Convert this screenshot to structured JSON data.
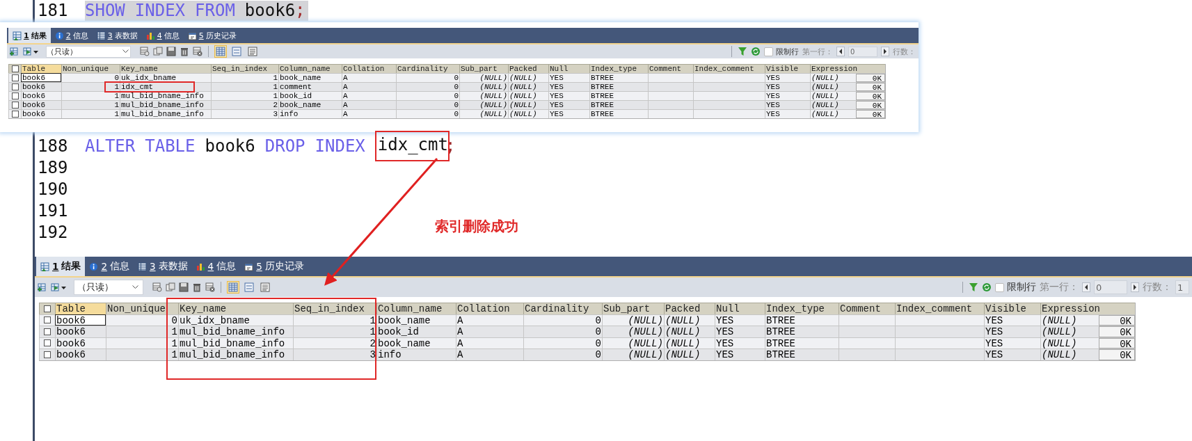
{
  "editor_before": {
    "lines": [
      {
        "number": "181",
        "selected": true,
        "tokens": [
          {
            "text": "SHOW",
            "kind": "keyword"
          },
          {
            "text": "INDEX",
            "kind": "keyword"
          },
          {
            "text": "FROM",
            "kind": "keyword"
          },
          {
            "text": "book6",
            "kind": "ident"
          },
          {
            "text": ";",
            "kind": "punct"
          }
        ]
      }
    ]
  },
  "result_panel_before": {
    "tabs": [
      {
        "number": "1",
        "label": "结果",
        "selected": true
      },
      {
        "number": "2",
        "label": "信息",
        "selected": false
      },
      {
        "number": "3",
        "label": "表数据",
        "selected": false
      },
      {
        "number": "4",
        "label": "信息",
        "selected": false
      },
      {
        "number": "5",
        "label": "历史记录",
        "selected": false
      }
    ],
    "mode": "（只读）",
    "views": [
      {
        "selected": true
      },
      {
        "selected": false
      },
      {
        "selected": false
      }
    ],
    "limit": {
      "label": "限制行",
      "checked": false
    },
    "first_row": {
      "label": "第一行：",
      "value": "0"
    },
    "row_count": {
      "label": "行数："
    },
    "all_checked": false,
    "columns": [
      {
        "name": "Table",
        "selected": true
      },
      {
        "name": "Non_unique",
        "selected": false
      },
      {
        "name": "Key_name",
        "selected": false
      },
      {
        "name": "Seq_in_index",
        "selected": false
      },
      {
        "name": "Column_name",
        "selected": false
      },
      {
        "name": "Collation",
        "selected": false
      },
      {
        "name": "Cardinality",
        "selected": false
      },
      {
        "name": "Sub_part",
        "selected": false
      },
      {
        "name": "Packed",
        "selected": false
      },
      {
        "name": "Null",
        "selected": false
      },
      {
        "name": "Index_type",
        "selected": false
      },
      {
        "name": "Comment",
        "selected": false
      },
      {
        "name": "Index_comment",
        "selected": false
      },
      {
        "name": "Visible",
        "selected": false
      },
      {
        "name": "Expression",
        "selected": false
      }
    ],
    "rows": [
      {
        "checked": false,
        "current": true,
        "cells": [
          "book6",
          "0",
          "uk_idx_bname",
          "1",
          "book_name",
          "A",
          "0",
          "(NULL)",
          "(NULL)",
          "YES",
          "BTREE",
          "",
          "",
          "YES",
          "(NULL)"
        ],
        "size": "0K"
      },
      {
        "checked": false,
        "current": false,
        "cells": [
          "book6",
          "1",
          "idx_cmt",
          "1",
          "comment",
          "A",
          "0",
          "(NULL)",
          "(NULL)",
          "YES",
          "BTREE",
          "",
          "",
          "YES",
          "(NULL)"
        ],
        "size": "0K"
      },
      {
        "checked": false,
        "current": false,
        "cells": [
          "book6",
          "1",
          "mul_bid_bname_info",
          "1",
          "book_id",
          "A",
          "0",
          "(NULL)",
          "(NULL)",
          "YES",
          "BTREE",
          "",
          "",
          "YES",
          "(NULL)"
        ],
        "size": "0K"
      },
      {
        "checked": false,
        "current": false,
        "cells": [
          "book6",
          "1",
          "mul_bid_bname_info",
          "2",
          "book_name",
          "A",
          "0",
          "(NULL)",
          "(NULL)",
          "YES",
          "BTREE",
          "",
          "",
          "YES",
          "(NULL)"
        ],
        "size": "0K"
      },
      {
        "checked": false,
        "current": false,
        "cells": [
          "book6",
          "1",
          "mul_bid_bname_info",
          "3",
          "info",
          "A",
          "0",
          "(NULL)",
          "(NULL)",
          "YES",
          "BTREE",
          "",
          "",
          "YES",
          "(NULL)"
        ],
        "size": "0K"
      }
    ]
  },
  "editor": {
    "lines": [
      {
        "number": "188",
        "selected": false,
        "tokens": [
          {
            "text": "ALTER",
            "kind": "keyword"
          },
          {
            "text": "TABLE",
            "kind": "keyword"
          },
          {
            "text": "book6",
            "kind": "ident"
          },
          {
            "text": "DROP",
            "kind": "keyword"
          },
          {
            "text": "INDEX",
            "kind": "keyword"
          },
          {
            "text": "idx_cmt",
            "kind": "circled"
          },
          {
            "text": ";",
            "kind": "punct"
          }
        ]
      },
      {
        "number": "189",
        "selected": false
      },
      {
        "number": "190",
        "selected": false
      },
      {
        "number": "191",
        "selected": false
      },
      {
        "number": "192",
        "selected": false
      }
    ]
  },
  "annotation": {
    "text": "索引删除成功"
  },
  "result_panel_after": {
    "tabs": [
      {
        "number": "1",
        "label": "结果",
        "selected": true
      },
      {
        "number": "2",
        "label": "信息",
        "selected": false
      },
      {
        "number": "3",
        "label": "表数据",
        "selected": false
      },
      {
        "number": "4",
        "label": "信息",
        "selected": false
      },
      {
        "number": "5",
        "label": "历史记录",
        "selected": false
      }
    ],
    "mode": "（只读）",
    "views": [
      {
        "selected": true
      },
      {
        "selected": false
      },
      {
        "selected": false
      }
    ],
    "limit": {
      "label": "限制行",
      "checked": false
    },
    "first_row": {
      "label": "第一行：",
      "value": "0"
    },
    "row_count": {
      "label": "行数：",
      "value": "1"
    },
    "all_checked": false,
    "columns": [
      {
        "name": "Table",
        "selected": true
      },
      {
        "name": "Non_unique",
        "selected": false
      },
      {
        "name": "Key_name",
        "selected": false
      },
      {
        "name": "Seq_in_index",
        "selected": false
      },
      {
        "name": "Column_name",
        "selected": false
      },
      {
        "name": "Collation",
        "selected": false
      },
      {
        "name": "Cardinality",
        "selected": false
      },
      {
        "name": "Sub_part",
        "selected": false
      },
      {
        "name": "Packed",
        "selected": false
      },
      {
        "name": "Null",
        "selected": false
      },
      {
        "name": "Index_type",
        "selected": false
      },
      {
        "name": "Comment",
        "selected": false
      },
      {
        "name": "Index_comment",
        "selected": false
      },
      {
        "name": "Visible",
        "selected": false
      },
      {
        "name": "Expression",
        "selected": false
      }
    ],
    "rows": [
      {
        "checked": false,
        "current": true,
        "cells": [
          "book6",
          "0",
          "uk_idx_bname",
          "1",
          "book_name",
          "A",
          "0",
          "(NULL)",
          "(NULL)",
          "YES",
          "BTREE",
          "",
          "",
          "YES",
          "(NULL)"
        ],
        "size": "0K"
      },
      {
        "checked": false,
        "current": false,
        "cells": [
          "book6",
          "1",
          "mul_bid_bname_info",
          "1",
          "book_id",
          "A",
          "0",
          "(NULL)",
          "(NULL)",
          "YES",
          "BTREE",
          "",
          "",
          "YES",
          "(NULL)"
        ],
        "size": "0K"
      },
      {
        "checked": false,
        "current": false,
        "cells": [
          "book6",
          "1",
          "mul_bid_bname_info",
          "2",
          "book_name",
          "A",
          "0",
          "(NULL)",
          "(NULL)",
          "YES",
          "BTREE",
          "",
          "",
          "YES",
          "(NULL)"
        ],
        "size": "0K"
      },
      {
        "checked": false,
        "current": false,
        "cells": [
          "book6",
          "1",
          "mul_bid_bname_info",
          "3",
          "info",
          "A",
          "0",
          "(NULL)",
          "(NULL)",
          "YES",
          "BTREE",
          "",
          "",
          "YES",
          "(NULL)"
        ],
        "size": "0K"
      }
    ]
  }
}
